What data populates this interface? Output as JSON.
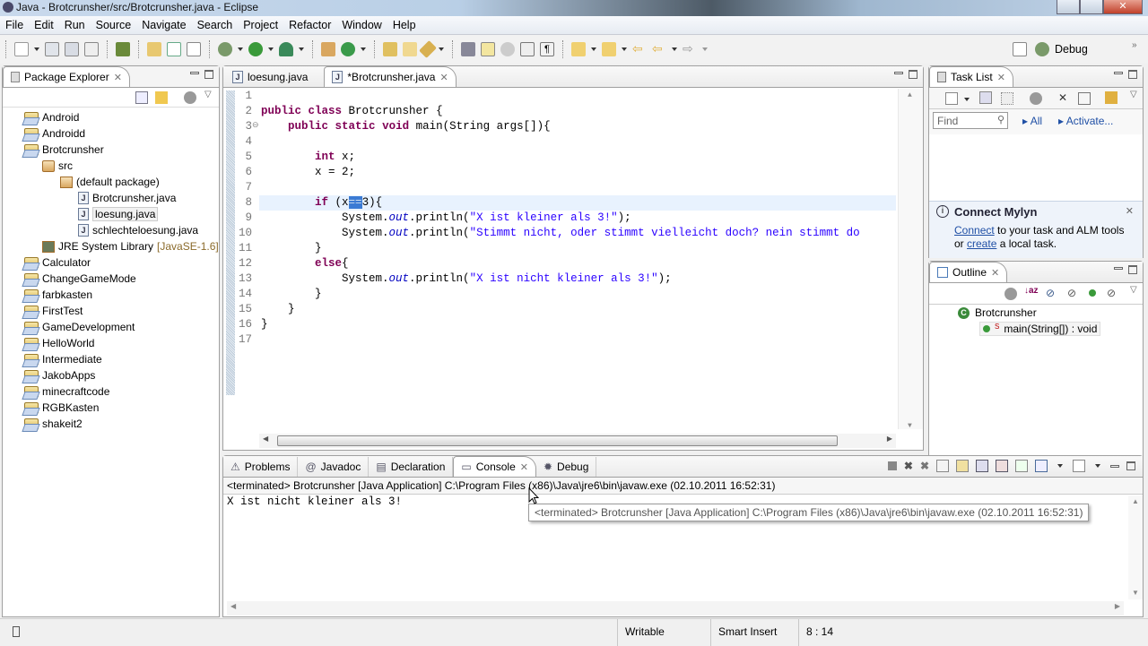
{
  "window": {
    "title": "Java - Brotcrunsher/src/Brotcrunsher.java - Eclipse"
  },
  "menu": [
    "File",
    "Edit",
    "Run",
    "Source",
    "Navigate",
    "Search",
    "Project",
    "Refactor",
    "Window",
    "Help"
  ],
  "perspective": {
    "label": "Debug"
  },
  "package_explorer": {
    "title": "Package Explorer",
    "items": [
      {
        "label": "Android",
        "level": 0,
        "type": "project-warning"
      },
      {
        "label": "Androidd",
        "level": 0,
        "type": "project"
      },
      {
        "label": "Brotcrunsher",
        "level": 0,
        "type": "project"
      },
      {
        "label": "src",
        "level": 1,
        "type": "source-folder"
      },
      {
        "label": "(default package)",
        "level": 2,
        "type": "package"
      },
      {
        "label": "Brotcrunsher.java",
        "level": 3,
        "type": "java-file"
      },
      {
        "label": "loesung.java",
        "level": 3,
        "type": "java-file",
        "selected": true
      },
      {
        "label": "schlechteloesung.java",
        "level": 3,
        "type": "java-file"
      },
      {
        "label": "JRE System Library",
        "suffix": "[JavaSE-1.6]",
        "level": 1,
        "type": "library"
      },
      {
        "label": "Calculator",
        "level": 0,
        "type": "project-warning"
      },
      {
        "label": "ChangeGameMode",
        "level": 0,
        "type": "project"
      },
      {
        "label": "farbkasten",
        "level": 0,
        "type": "project-warning"
      },
      {
        "label": "FirstTest",
        "level": 0,
        "type": "project-warning"
      },
      {
        "label": "GameDevelopment",
        "level": 0,
        "type": "project-warning"
      },
      {
        "label": "HelloWorld",
        "level": 0,
        "type": "project"
      },
      {
        "label": "Intermediate",
        "level": 0,
        "type": "project-warning"
      },
      {
        "label": "JakobApps",
        "level": 0,
        "type": "project-warning"
      },
      {
        "label": "minecraftcode",
        "level": 0,
        "type": "project-warning"
      },
      {
        "label": "RGBKasten",
        "level": 0,
        "type": "project-warning"
      },
      {
        "label": "shakeit2",
        "level": 0,
        "type": "project-warning"
      }
    ]
  },
  "editor": {
    "tabs": [
      {
        "label": "loesung.java",
        "active": false
      },
      {
        "label": "*Brotcrunsher.java",
        "active": true
      }
    ],
    "lines": [
      {
        "n": "1",
        "code": ""
      },
      {
        "n": "2",
        "code": "public class Brotcrunsher {"
      },
      {
        "n": "3",
        "code": "    public static void main(String args[]){"
      },
      {
        "n": "4",
        "code": ""
      },
      {
        "n": "5",
        "code": "        int x;"
      },
      {
        "n": "6",
        "code": "        x = 2;"
      },
      {
        "n": "7",
        "code": ""
      },
      {
        "n": "8",
        "code": "        if (x==3){"
      },
      {
        "n": "9",
        "code": "            System.out.println(\"X ist kleiner als 3!\");"
      },
      {
        "n": "10",
        "code": "            System.out.println(\"Stimmt nicht, oder stimmt vielleicht doch? nein stimmt do"
      },
      {
        "n": "11",
        "code": "        }"
      },
      {
        "n": "12",
        "code": "        else{"
      },
      {
        "n": "13",
        "code": "            System.out.println(\"X ist nicht kleiner als 3!\");"
      },
      {
        "n": "14",
        "code": "        }"
      },
      {
        "n": "15",
        "code": "    }"
      },
      {
        "n": "16",
        "code": "}"
      },
      {
        "n": "17",
        "code": ""
      }
    ],
    "current_line": 8
  },
  "task_list": {
    "title": "Task List",
    "find_placeholder": "Find",
    "filter_all": "All",
    "filter_activate": "Activate...",
    "mylyn_title": "Connect Mylyn",
    "mylyn_connect": "Connect",
    "mylyn_text1": " to your task and ALM tools",
    "mylyn_or": "or ",
    "mylyn_create": "create",
    "mylyn_text2": " a local task."
  },
  "outline": {
    "title": "Outline",
    "class_name": "Brotcrunsher",
    "method": "main(String[]) : void"
  },
  "bottom": {
    "tabs": [
      {
        "label": "Problems",
        "active": false
      },
      {
        "label": "Javadoc",
        "active": false
      },
      {
        "label": "Declaration",
        "active": false
      },
      {
        "label": "Console",
        "active": true
      },
      {
        "label": "Debug",
        "active": false
      }
    ],
    "console_header": "<terminated> Brotcrunsher [Java Application] C:\\Program Files (x86)\\Java\\jre6\\bin\\javaw.exe (02.10.2011 16:52:31)",
    "console_output": "X ist nicht kleiner als 3!",
    "tooltip": "<terminated> Brotcrunsher [Java Application] C:\\Program Files (x86)\\Java\\jre6\\bin\\javaw.exe (02.10.2011 16:52:31)"
  },
  "statusbar": {
    "writable": "Writable",
    "insert_mode": "Smart Insert",
    "position": "8 : 14"
  }
}
